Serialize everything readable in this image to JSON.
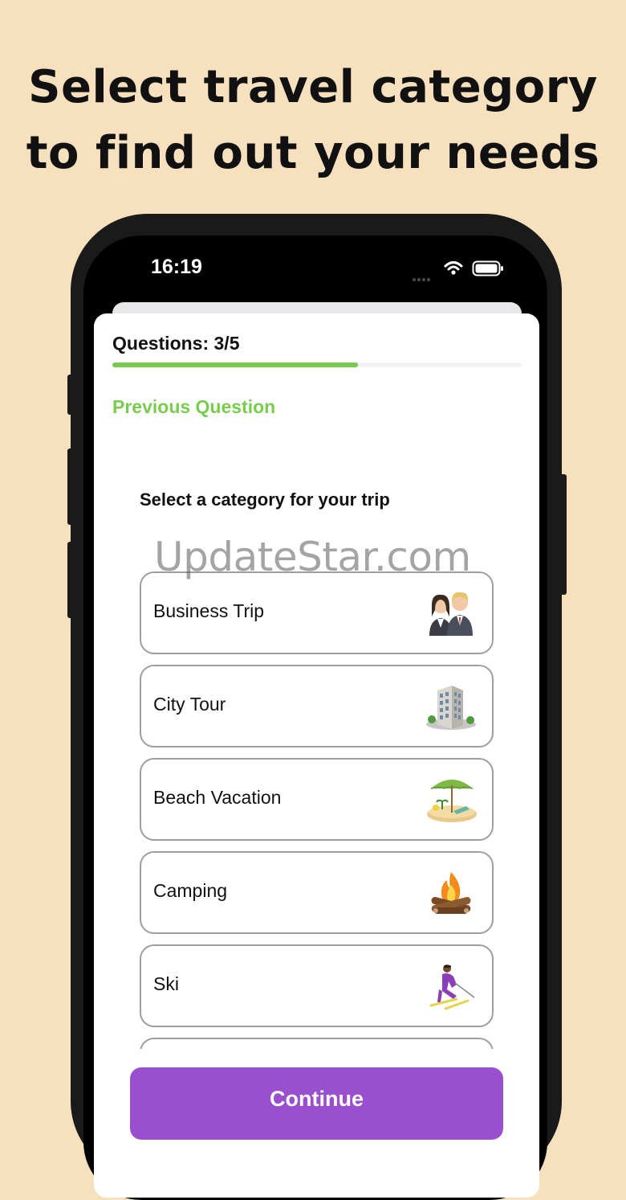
{
  "headline": {
    "line1": "Select travel category",
    "line2": "to find out your needs"
  },
  "status_bar": {
    "time": "16:19",
    "icons": [
      "signal-dots-icon",
      "wifi-icon",
      "battery-icon"
    ]
  },
  "quiz": {
    "question_count": "Questions: 3/5",
    "progress_fraction": 0.6,
    "previous_label": "Previous Question",
    "prompt": "Select a category for your trip",
    "options": [
      {
        "label": "Business Trip",
        "icon": "business-people-icon"
      },
      {
        "label": "City Tour",
        "icon": "office-building-icon"
      },
      {
        "label": "Beach Vacation",
        "icon": "beach-umbrella-icon"
      },
      {
        "label": "Camping",
        "icon": "campfire-icon"
      },
      {
        "label": "Ski",
        "icon": "skier-icon"
      }
    ],
    "continue_label": "Continue"
  },
  "watermark": "UpdateStar.com",
  "colors": {
    "background": "#f6e0bd",
    "accent_green": "#78cc4e",
    "button_purple": "#9a4fcf"
  }
}
